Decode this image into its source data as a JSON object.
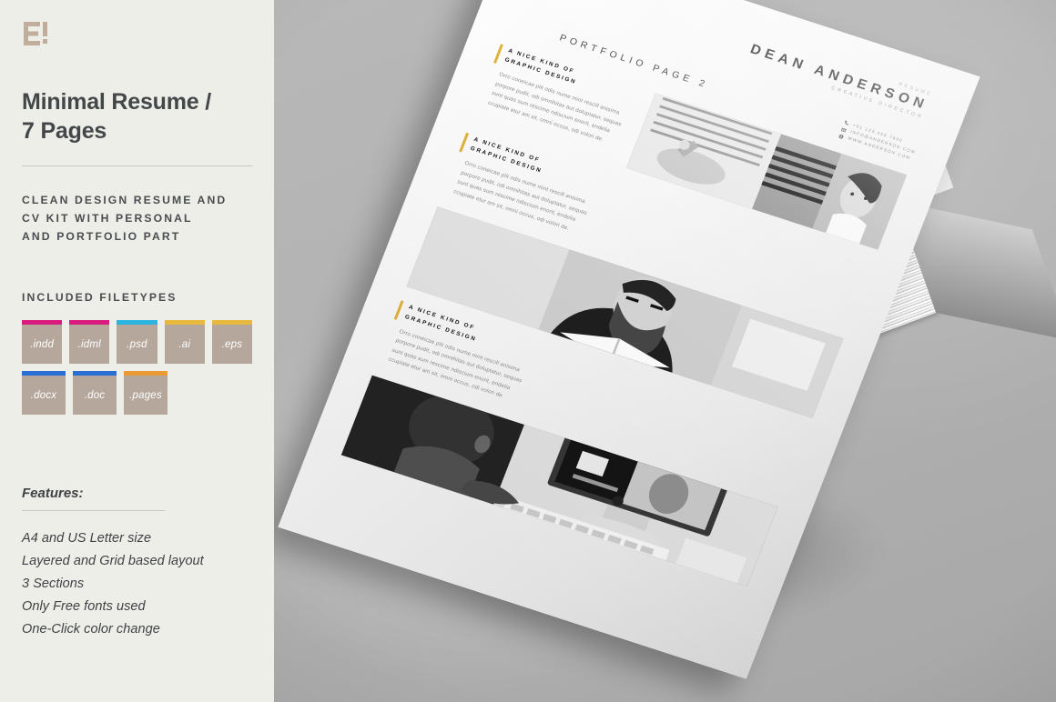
{
  "sidebar": {
    "logo_icon": "e-exclamation-logo",
    "title": "Minimal Resume /\n7 Pages",
    "tagline": "CLEAN DESIGN RESUME AND\nCV KIT WITH PERSONAL\nAND PORTFOLIO PART",
    "filetypes_label": "INCLUDED FILETYPES",
    "filetypes": [
      {
        "ext": ".indd",
        "bar_color": "#d81b7e"
      },
      {
        "ext": ".idml",
        "bar_color": "#d81b7e"
      },
      {
        "ext": ".psd",
        "bar_color": "#2bb5e0"
      },
      {
        "ext": ".ai",
        "bar_color": "#e8b93c"
      },
      {
        "ext": ".eps",
        "bar_color": "#e8b93c"
      },
      {
        "ext": ".docx",
        "bar_color": "#2a6fd4"
      },
      {
        "ext": ".doc",
        "bar_color": "#2a6fd4"
      },
      {
        "ext": ".pages",
        "bar_color": "#ea9a33"
      }
    ],
    "badge_bg": "#b5a79c",
    "features_label": "Features:",
    "features": [
      "A4 and US Letter size",
      "Layered and Grid based layout",
      "3 Sections",
      "Only Free fonts used",
      "One-Click color change"
    ]
  },
  "document": {
    "kicker": "RESUME",
    "name": "DEAN ANDERSON",
    "role": "CREATIVE DIRECTOR",
    "page_title": "PORTFOLIO PAGE 2",
    "contact": [
      {
        "icon": "phone-icon",
        "text": "+01 123 456 7890"
      },
      {
        "icon": "mail-icon",
        "text": "INFO@ANDERSON.COM"
      },
      {
        "icon": "globe-icon",
        "text": "WWW.ANDERSON.COM"
      }
    ],
    "accent_color": "#e0b23a",
    "blocks": [
      {
        "heading": "A NICE KIND OF\nGRAPHIC DESIGN",
        "body": "Orro coneicae plit odis nume mint rescill anisima porpore pudit, odi omnihitas aut doluptatur, sequas sunt quas sum rescime ndiscium enorit, endelia ccupiate etur am sit, omni occus, odi volori de.",
        "photo": "desk-lamp-and-woman-thinking-photo"
      },
      {
        "heading": "A NICE KIND OF\nGRAPHIC DESIGN",
        "body": "Orro coneicae plit odis nume mint rescill anisima porpore pudit, odi omnihitas aut doluptatur, sequas sunt quas sum rescime ndiscium enorit, endelia ccupiate etur am sit, omni occus, odi volori de.",
        "photo": "bearded-man-reading-book-photo"
      },
      {
        "heading": "A NICE KIND OF\nGRAPHIC DESIGN",
        "body": "Orro coneicae plit odis nume mint rescill anisima porpore pudit, odi omnihitas aut doluptatur, sequas sunt quas sum rescime ndiscium enorit, endelia ccupiate etur am sit, omni occus, odi volori de.",
        "photo": "person-at-imac-computer-photo"
      }
    ]
  }
}
